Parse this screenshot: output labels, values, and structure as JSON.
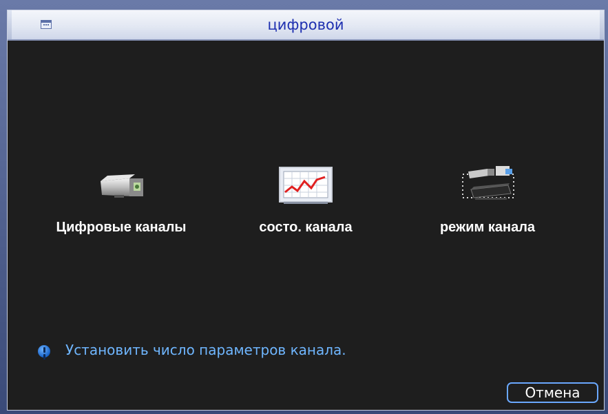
{
  "window": {
    "title": "цифровой",
    "title_icon": "window-list-icon"
  },
  "options": [
    {
      "label": "Цифровые каналы",
      "icon": "ip-camera-icon"
    },
    {
      "label": "состо. канала",
      "icon": "line-chart-icon"
    },
    {
      "label": "режим канала",
      "icon": "camera-recorder-icon"
    }
  ],
  "hint": {
    "icon": "info-icon",
    "text": "Установить число параметров канала."
  },
  "buttons": {
    "cancel_label": "Отмена"
  },
  "colors": {
    "title_text": "#1d2fb0",
    "background": "#1e1e1e",
    "hint_text": "#6fb6ff",
    "button_border": "#6aa8ff"
  }
}
